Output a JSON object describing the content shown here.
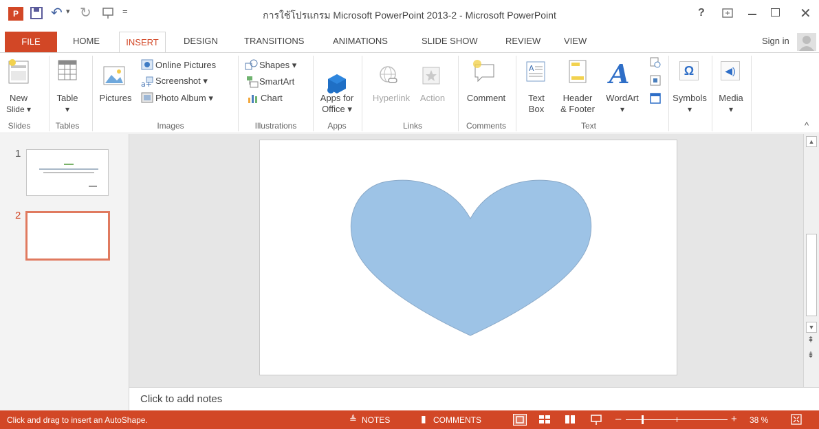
{
  "window": {
    "title": "การใช้โปรแกรม Microsoft PowerPoint 2013-2 - Microsoft PowerPoint",
    "help": "?",
    "ribbon_display_icon": "ribbon-display-options-icon",
    "minimize_icon": "minimize-icon",
    "restore_icon": "maximize-icon",
    "close_icon": "close-icon"
  },
  "quick_access": {
    "app_icon": "powerpoint-logo-icon",
    "save_icon": "save-icon",
    "undo_icon": "undo-icon",
    "redo_icon": "redo-icon",
    "customize_icon": "customize-qat-icon"
  },
  "tabs": [
    {
      "label": "FILE"
    },
    {
      "label": "HOME"
    },
    {
      "label": "INSERT"
    },
    {
      "label": "DESIGN"
    },
    {
      "label": "TRANSITIONS"
    },
    {
      "label": "ANIMATIONS"
    },
    {
      "label": "SLIDE SHOW"
    },
    {
      "label": "REVIEW"
    },
    {
      "label": "VIEW"
    }
  ],
  "signin": {
    "label": "Sign in"
  },
  "ribbon": {
    "groups": {
      "slides": "Slides",
      "tables": "Tables",
      "images": "Images",
      "illustrations": "Illustrations",
      "apps": "Apps",
      "links": "Links",
      "comments": "Comments",
      "text": "Text"
    },
    "new_slide": {
      "line1": "New",
      "line2": "Slide ▾"
    },
    "table": {
      "line1": "Table",
      "line2": "▾"
    },
    "pictures": {
      "label": "Pictures"
    },
    "online_pictures": {
      "label": "Online Pictures"
    },
    "screenshot": {
      "label": "Screenshot ▾"
    },
    "photo_album": {
      "label": "Photo Album  ▾"
    },
    "shapes": {
      "label": "Shapes ▾"
    },
    "smartart": {
      "label": "SmartArt"
    },
    "chart": {
      "label": "Chart"
    },
    "apps_for_office": {
      "line1": "Apps for",
      "line2": "Office ▾"
    },
    "hyperlink": {
      "label": "Hyperlink"
    },
    "action": {
      "label": "Action"
    },
    "comment": {
      "label": "Comment"
    },
    "text_box": {
      "line1": "Text",
      "line2": "Box"
    },
    "header_footer": {
      "line1": "Header",
      "line2": "& Footer"
    },
    "wordart": {
      "line1": "WordArt",
      "line2": "▾"
    },
    "symbols": {
      "line1": "Symbols",
      "line2": "▾"
    },
    "media": {
      "line1": "Media",
      "line2": "▾"
    },
    "collapse": "^"
  },
  "slides": [
    {
      "number": "1",
      "selected": false
    },
    {
      "number": "2",
      "selected": true
    }
  ],
  "canvas": {
    "shape_name": "heart",
    "shape_fill": "#9dc3e6",
    "shape_stroke": "#8aa9c8"
  },
  "notes": {
    "placeholder": "Click to add notes"
  },
  "status": {
    "message": "Click and drag to insert an AutoShape.",
    "notes": "NOTES",
    "comments": "COMMENTS",
    "zoom": "38 %",
    "zoom_level_percent": 38
  },
  "colors": {
    "accent": "#d24726",
    "status_bar": "#d24726"
  }
}
